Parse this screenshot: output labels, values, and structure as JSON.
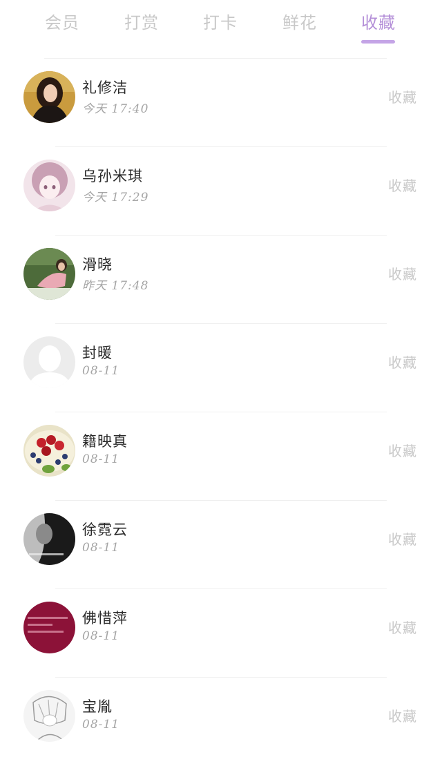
{
  "tabs": [
    {
      "label": "会员",
      "active": false
    },
    {
      "label": "打赏",
      "active": false
    },
    {
      "label": "打卡",
      "active": false
    },
    {
      "label": "鲜花",
      "active": false
    },
    {
      "label": "收藏",
      "active": true
    }
  ],
  "colors": {
    "accent": "#b48fd8",
    "tab_inactive": "#c8c8c8",
    "name": "#2a2a2a",
    "time": "#a5a5a5",
    "action": "#c9c9c9"
  },
  "users": [
    {
      "name": "礼修洁",
      "time": "今天 17:40",
      "action": "收藏",
      "avatar": "portrait-woman-avatar"
    },
    {
      "name": "乌孙米琪",
      "time": "今天 17:29",
      "action": "收藏",
      "avatar": "anime-girl-avatar"
    },
    {
      "name": "滑晓",
      "time": "昨天 17:48",
      "action": "收藏",
      "avatar": "woman-garden-avatar"
    },
    {
      "name": "封暖",
      "time": "08-11",
      "action": "收藏",
      "avatar": "default-person-avatar"
    },
    {
      "name": "籍映真",
      "time": "08-11",
      "action": "收藏",
      "avatar": "fruit-tart-avatar"
    },
    {
      "name": "徐霓云",
      "time": "08-11",
      "action": "收藏",
      "avatar": "dark-portrait-avatar"
    },
    {
      "name": "佛惜萍",
      "time": "08-11",
      "action": "收藏",
      "avatar": "red-text-avatar"
    },
    {
      "name": "宝胤",
      "time": "08-11",
      "action": "收藏",
      "avatar": "sketch-avatar"
    }
  ]
}
